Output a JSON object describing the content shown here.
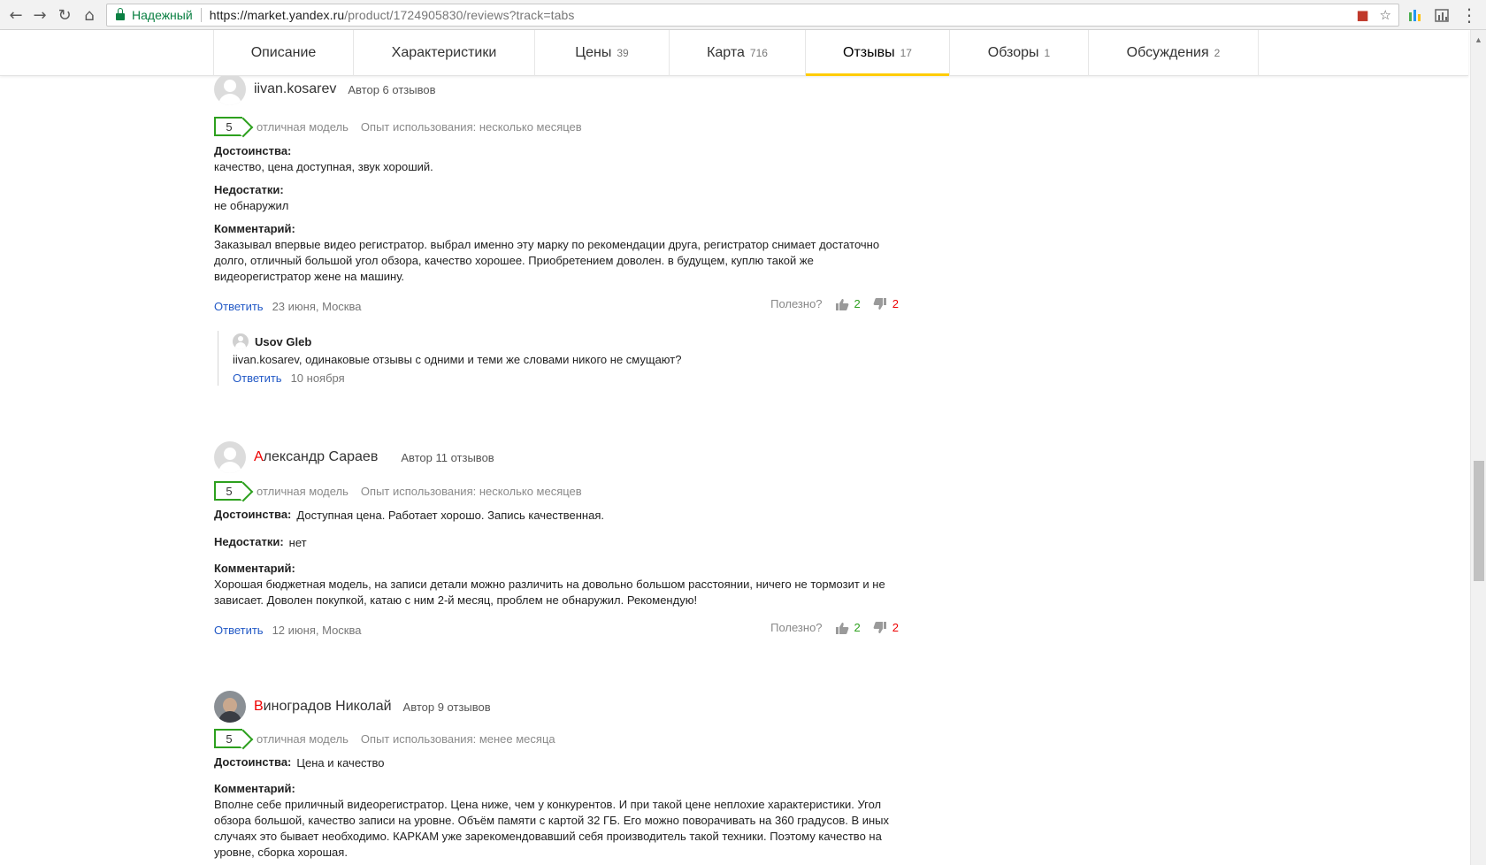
{
  "browser": {
    "secure_label": "Надежный",
    "url_main": "https://market.yandex.ru",
    "url_path": "/product/1724905830/reviews?track=tabs"
  },
  "tabs": [
    {
      "label": "Описание",
      "count": "",
      "active": false
    },
    {
      "label": "Характеристики",
      "count": "",
      "active": false
    },
    {
      "label": "Цены",
      "count": "39",
      "active": false
    },
    {
      "label": "Карта",
      "count": "716",
      "active": false
    },
    {
      "label": "Отзывы",
      "count": "17",
      "active": true
    },
    {
      "label": "Обзоры",
      "count": "1",
      "active": false
    },
    {
      "label": "Обсуждения",
      "count": "2",
      "active": false
    }
  ],
  "colors": {
    "rating_green": "#2da01e",
    "link_blue": "#2259c6",
    "author_first_letter": "#ee0000",
    "active_tab_underline": "#ffcc00"
  },
  "reviews": [
    {
      "author_first": "",
      "author_rest": "iivan.kosarev",
      "author_meta": "Автор 6 отзывов",
      "rating": "5",
      "rating_text": "отличная модель",
      "usage": "Опыт использования: несколько месяцев",
      "pros_title": "Достоинства:",
      "pros": "качество, цена доступная, звук хороший.",
      "cons_title": "Недостатки:",
      "cons": "не обнаружил",
      "comment_title": "Комментарий:",
      "comment": "Заказывал впервые видео регистратор. выбрал именно эту марку по рекомендации друга, регистратор снимает достаточно долго, отличный большой угол обзора, качество хорошее. Приобретением доволен. в будущем, куплю такой же видеорегистратор жене на машину.",
      "reply_label": "Ответить",
      "date": "23 июня, Москва",
      "helpful_label": "Полезно?",
      "likes": "2",
      "dislikes": "2",
      "reply": {
        "name": "Usov Gleb",
        "text": "iivan.kosarev, одинаковые отзывы с одними и теми же словами никого не смущают?",
        "reply_label": "Ответить",
        "date": "10 ноября"
      }
    },
    {
      "author_first": "А",
      "author_rest": "лександр Сараев",
      "author_meta": "Автор 11 отзывов",
      "rating": "5",
      "rating_text": "отличная модель",
      "usage": "Опыт использования: несколько месяцев",
      "pros_title": "Достоинства:",
      "pros": "Доступная цена. Работает хорошо. Запись качественная.",
      "cons_title": "Недостатки:",
      "cons": "нет",
      "comment_title": "Комментарий:",
      "comment": "Хорошая бюджетная модель, на записи детали можно различить на довольно большом расстоянии, ничего не тормозит и не зависает. Доволен покупкой, катаю с ним 2-й месяц, проблем не обнаружил. Рекомендую!",
      "reply_label": "Ответить",
      "date": "12 июня, Москва",
      "helpful_label": "Полезно?",
      "likes": "2",
      "dislikes": "2"
    },
    {
      "author_first": "В",
      "author_rest": "иноградов Николай",
      "author_meta": "Автор 9 отзывов",
      "rating": "5",
      "rating_text": "отличная модель",
      "usage": "Опыт использования: менее месяца",
      "pros_title": "Достоинства:",
      "pros": "Цена и качество",
      "comment_title": "Комментарий:",
      "comment": "Вполне себе приличный видеорегистратор. Цена ниже, чем у конкурентов. И при такой цене неплохие характеристики. Угол обзора большой, качество записи на уровне. Объём памяти с картой 32 ГБ. Его можно поворачивать на 360 градусов. В иных случаях это бывает необходимо. КАРКАМ уже зарекомендовавший себя производитель такой техники. Поэтому качество на уровне, сборка хорошая."
    }
  ]
}
